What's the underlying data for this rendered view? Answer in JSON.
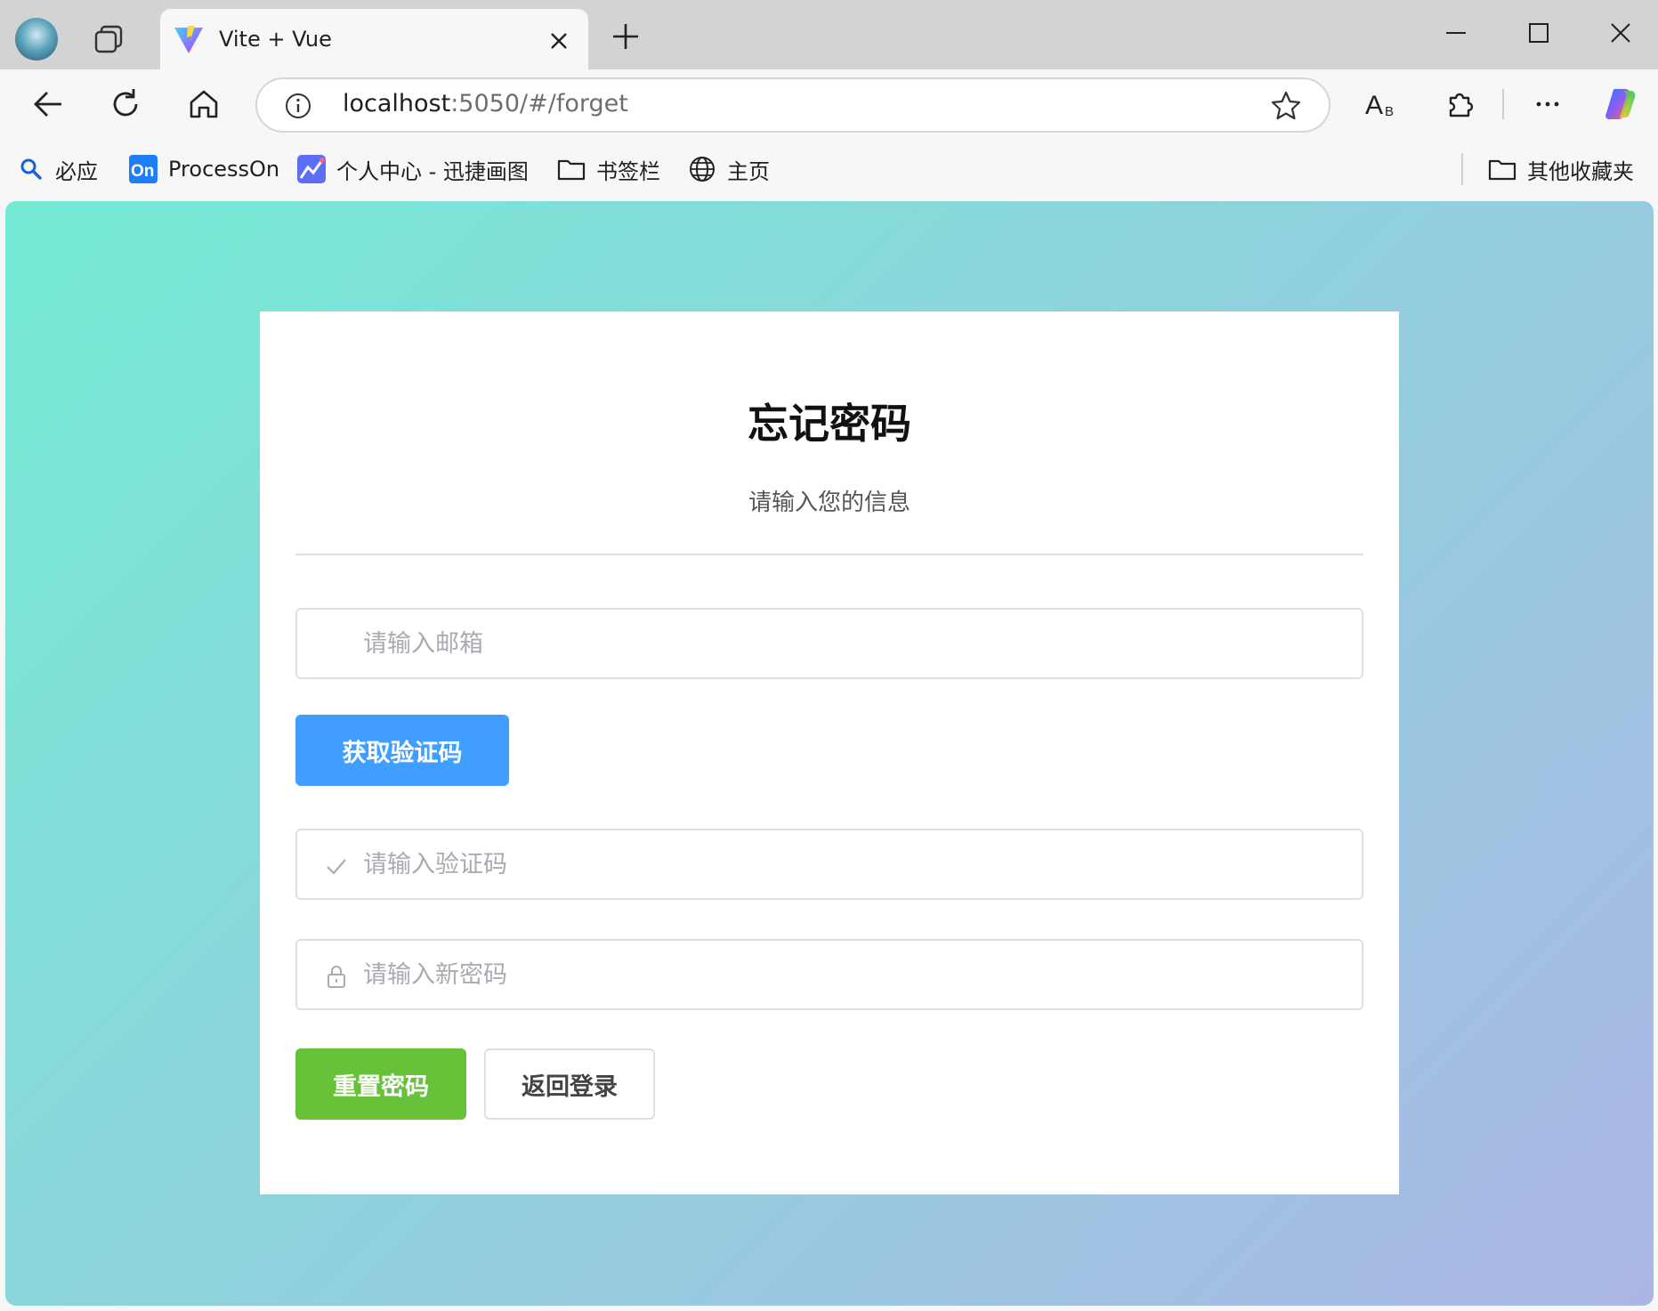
{
  "browser": {
    "tab_title": "Vite + Vue",
    "url_host": "localhost",
    "url_path": ":5050/#/forget",
    "bookmarks": [
      {
        "label": "必应",
        "icon": "bing-search-icon"
      },
      {
        "label": "ProcessOn",
        "icon": "processon-icon"
      },
      {
        "label": "个人中心 - 迅捷画图",
        "icon": "xunjie-icon"
      },
      {
        "label": "书签栏",
        "icon": "folder-icon"
      },
      {
        "label": "主页",
        "icon": "globe-icon"
      }
    ],
    "other_bookmarks": "其他收藏夹"
  },
  "form": {
    "title": "忘记密码",
    "subtitle": "请输入您的信息",
    "email_placeholder": "请输入邮箱",
    "get_code_label": "获取验证码",
    "code_placeholder": "请输入验证码",
    "password_placeholder": "请输入新密码",
    "reset_label": "重置密码",
    "back_label": "返回登录"
  },
  "colors": {
    "primary": "#409eff",
    "success": "#67c23a",
    "gradient_start": "#74ebd5",
    "gradient_end": "#acb6e5"
  }
}
